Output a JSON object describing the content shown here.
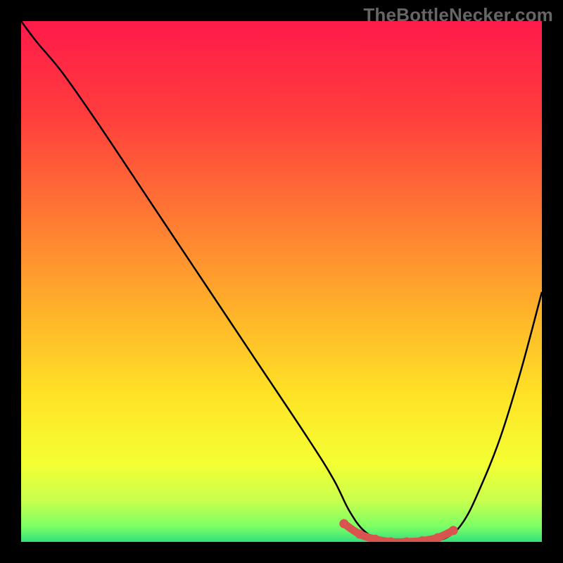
{
  "watermark": "TheBottleNecker.com",
  "chart_data": {
    "type": "line",
    "title": "",
    "xlabel": "",
    "ylabel": "",
    "xlim": [
      0,
      100
    ],
    "ylim": [
      0,
      100
    ],
    "series": [
      {
        "name": "curve",
        "color": "#000000",
        "x": [
          0,
          3,
          8,
          15,
          25,
          35,
          45,
          55,
          60,
          63,
          66,
          70,
          74,
          78,
          82,
          85,
          88,
          92,
          96,
          100
        ],
        "y": [
          100,
          96,
          90,
          80,
          65,
          50,
          35,
          20,
          12,
          6,
          2,
          0,
          0,
          0,
          1,
          4,
          10,
          20,
          33,
          48
        ]
      },
      {
        "name": "highlight-segment",
        "color": "#d9534f",
        "x": [
          62,
          65,
          68,
          71,
          74,
          77,
          80,
          83
        ],
        "y": [
          3.5,
          1.5,
          0.5,
          0,
          0,
          0.2,
          0.8,
          2.2
        ]
      }
    ],
    "background_gradient": {
      "stops": [
        {
          "offset": 0.0,
          "color": "#ff1a4b"
        },
        {
          "offset": 0.18,
          "color": "#ff3d3d"
        },
        {
          "offset": 0.38,
          "color": "#ff7a33"
        },
        {
          "offset": 0.55,
          "color": "#ffb02a"
        },
        {
          "offset": 0.72,
          "color": "#ffe326"
        },
        {
          "offset": 0.85,
          "color": "#f4ff33"
        },
        {
          "offset": 0.92,
          "color": "#c9ff4d"
        },
        {
          "offset": 0.97,
          "color": "#7dff66"
        },
        {
          "offset": 1.0,
          "color": "#33e07a"
        }
      ]
    }
  }
}
